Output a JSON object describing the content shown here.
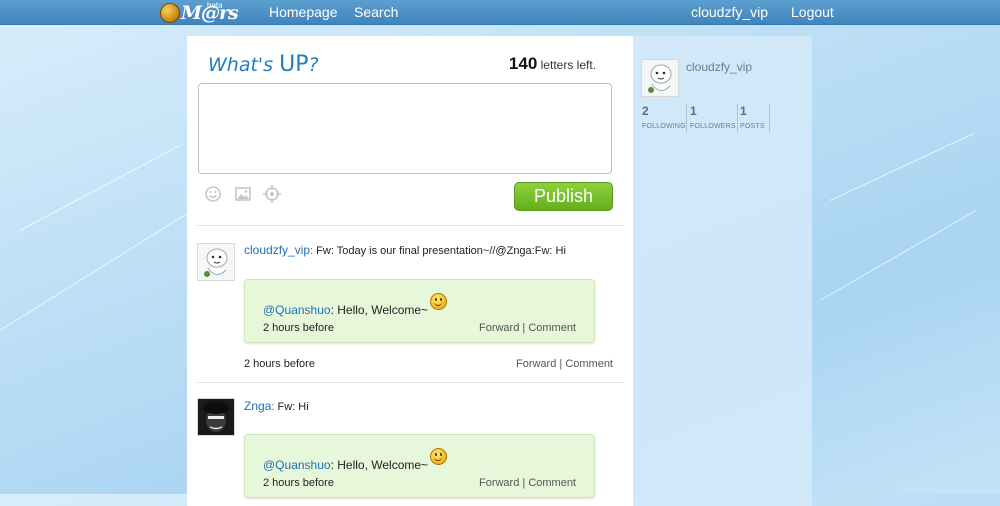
{
  "topbar": {
    "logo_text": "M@rs",
    "logo_badge": "beta",
    "nav_home": "Homepage",
    "nav_search": "Search",
    "user": "cloudzfy_vip",
    "logout": "Logout"
  },
  "composer": {
    "title_prefix": "What's",
    "title_main": "UP",
    "title_suffix": "?",
    "counter_value": "140",
    "counter_label": "letters left.",
    "textarea_value": "",
    "publish_label": "Publish",
    "tools": [
      "smiley-icon",
      "image-icon",
      "location-icon"
    ]
  },
  "posts": [
    {
      "user": "cloudzfy_vip",
      "colon": ":",
      "text": "Fw: Today is our final presentation~//@Znga:Fw: Hi",
      "quote": {
        "mention": "@Quanshuo",
        "text": ": Hello, Welcome~",
        "time": "2 hours before",
        "forward": "Forward",
        "sep": "|",
        "comment": "Comment"
      },
      "time": "2 hours before",
      "forward": "Forward",
      "sep": "|",
      "comment": "Comment"
    },
    {
      "user": "Znga",
      "colon": ":",
      "text": "Fw: Hi",
      "quote": {
        "mention": "@Quanshuo",
        "text": ": Hello, Welcome~",
        "time": "2 hours before",
        "forward": "Forward",
        "sep": "|",
        "comment": "Comment"
      }
    }
  ],
  "sidebar": {
    "username": "cloudzfy_vip",
    "stats": [
      {
        "value": "2",
        "label": "FOLLOWING"
      },
      {
        "value": "1",
        "label": "FOLLOWERS"
      },
      {
        "value": "1",
        "label": "POSTS"
      }
    ]
  },
  "colors": {
    "topbar": "#4a8fc4",
    "link": "#1f6fb6",
    "publish": "#77bf2a",
    "quote_bg": "#e6f8d9"
  }
}
